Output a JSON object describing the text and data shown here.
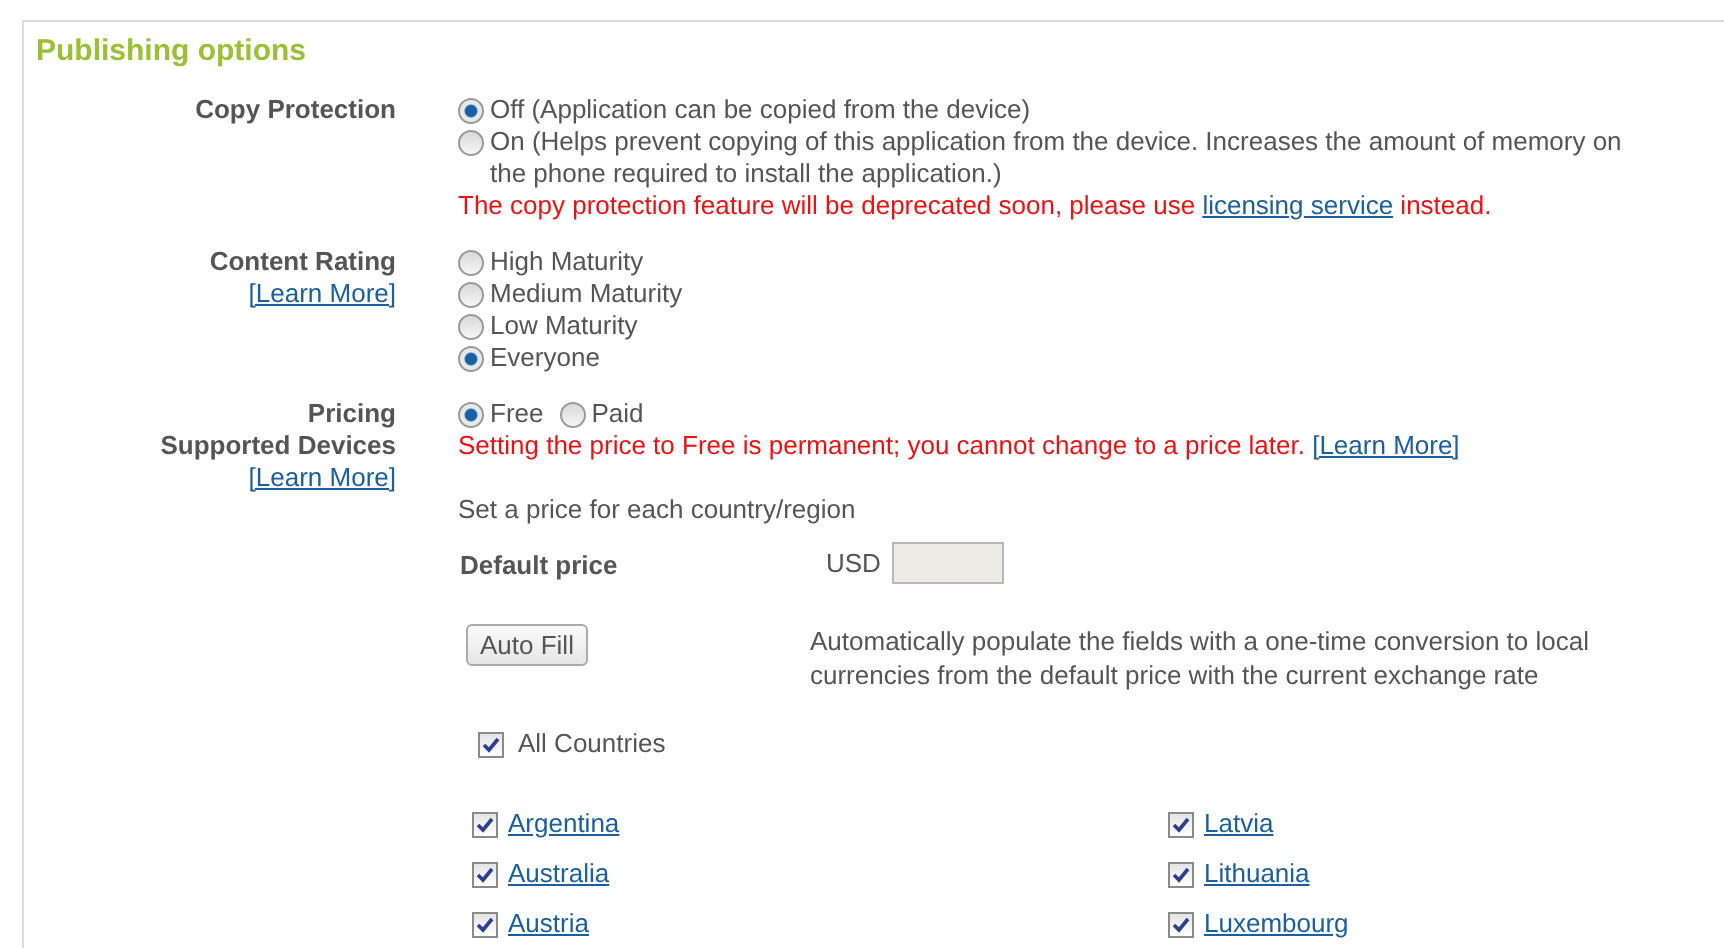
{
  "section": {
    "title": "Publishing options"
  },
  "copy_protection": {
    "label": "Copy Protection",
    "options": [
      {
        "label": "Off (Application can be copied from the device)",
        "selected": true
      },
      {
        "label": "On (Helps prevent copying of this application from the device. Increases the amount of memory on the phone required to install the application.)",
        "selected": false
      }
    ],
    "warning": {
      "before": "The copy protection feature will be deprecated soon, please use ",
      "link": "licensing service",
      "after": " instead."
    }
  },
  "content_rating": {
    "label": "Content Rating",
    "link": "[Learn More]",
    "options": [
      {
        "label": "High Maturity",
        "selected": false
      },
      {
        "label": "Medium Maturity",
        "selected": false
      },
      {
        "label": "Low Maturity",
        "selected": false
      },
      {
        "label": "Everyone",
        "selected": true
      }
    ]
  },
  "pricing": {
    "label": "Pricing",
    "label_2": "Supported Devices",
    "link": "[Learn More]",
    "options": [
      {
        "label": "Free",
        "selected": true
      },
      {
        "label": "Paid",
        "selected": false
      }
    ],
    "warning": {
      "before": "Setting the price to Free is permanent; you cannot change to a price later. ",
      "link": "[Learn More]"
    },
    "hint": "Set a price for each country/region",
    "default_price": {
      "label": "Default price",
      "currency": "USD"
    },
    "auto_fill": {
      "button": "Auto Fill",
      "description": "Automatically populate the fields with a one-time conversion to local currencies from the default price with the current exchange rate"
    },
    "all_countries": {
      "label": "All Countries",
      "checked": true
    },
    "countries": [
      {
        "name": "Argentina",
        "checked": true
      },
      {
        "name": "Latvia",
        "checked": true
      },
      {
        "name": "Australia",
        "checked": true
      },
      {
        "name": "Lithuania",
        "checked": true
      },
      {
        "name": "Austria",
        "checked": true
      },
      {
        "name": "Luxembourg",
        "checked": true
      }
    ]
  }
}
